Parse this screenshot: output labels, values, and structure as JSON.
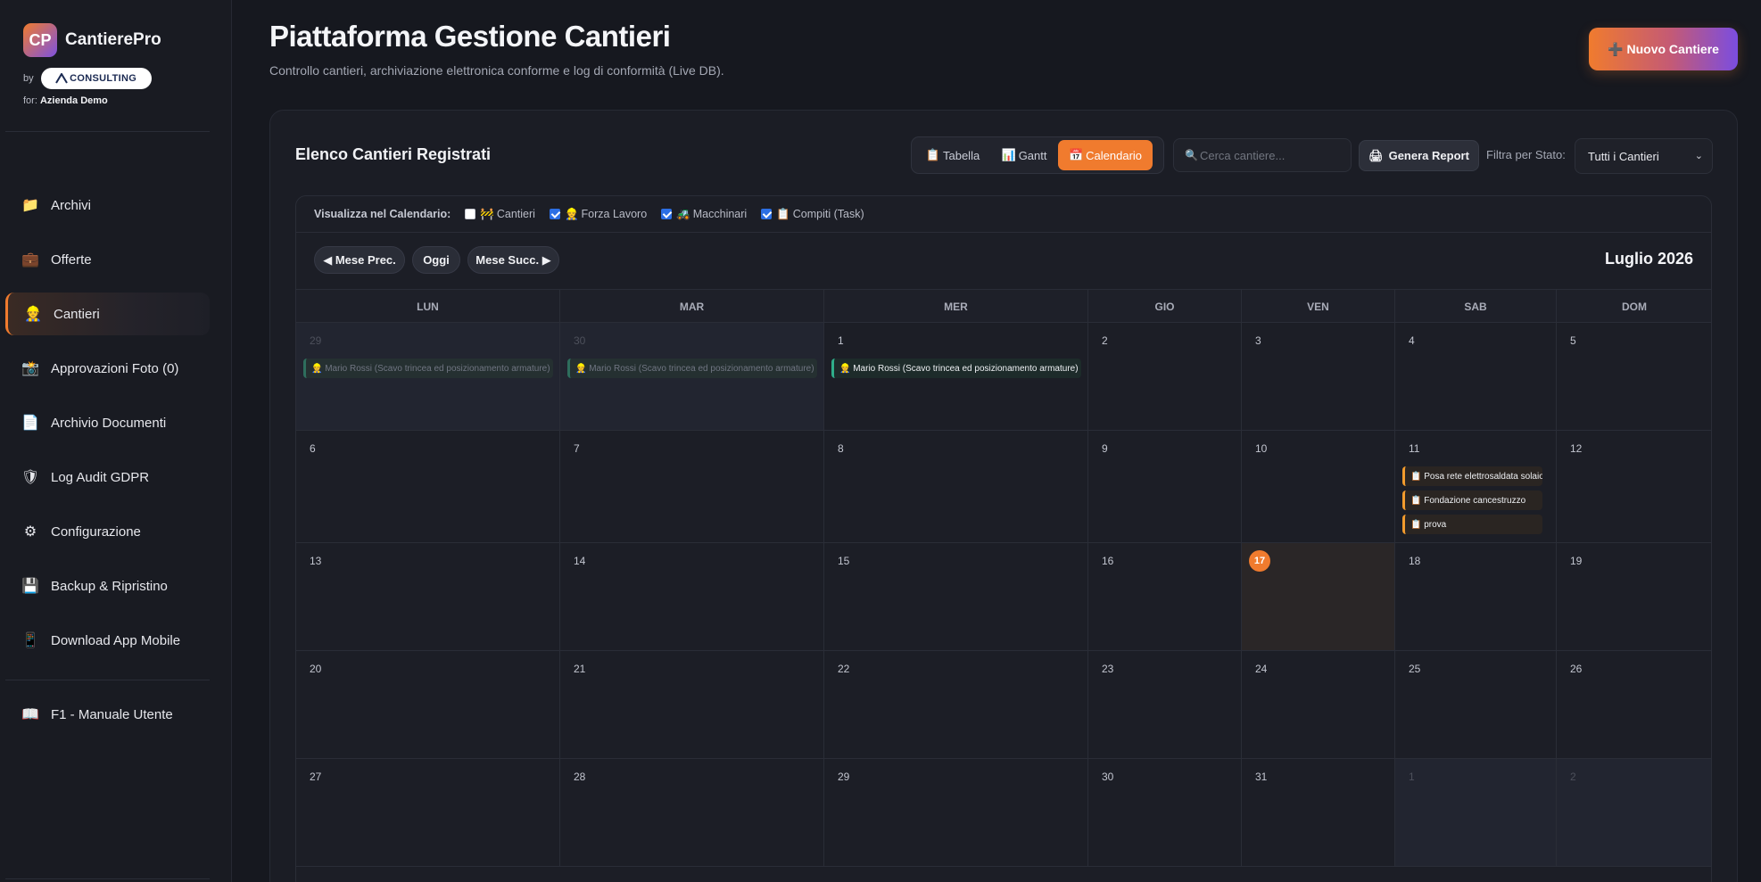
{
  "brand": {
    "logo_text": "CP",
    "name": "CantierePro",
    "by": "by",
    "partner_logo": "CONSULTING",
    "for_label": "for:",
    "company": "Azienda Demo"
  },
  "sidebar": {
    "items": [
      {
        "label": "Archivi",
        "icon": "folder-icon",
        "glyph": "📁"
      },
      {
        "label": "Offerte",
        "icon": "briefcase-icon",
        "glyph": "💼"
      },
      {
        "label": "Cantieri",
        "icon": "worker-icon",
        "glyph": "👷"
      },
      {
        "label": "Approvazioni Foto (0)",
        "icon": "camera-icon",
        "glyph": "📸"
      },
      {
        "label": "Archivio Documenti",
        "icon": "document-icon",
        "glyph": "📄"
      },
      {
        "label": "Log Audit GDPR",
        "icon": "shield-icon",
        "glyph": "🛡"
      },
      {
        "label": "Configurazione",
        "icon": "gear-icon",
        "glyph": "⚙"
      },
      {
        "label": "Backup & Ripristino",
        "icon": "floppy-icon",
        "glyph": "💾"
      },
      {
        "label": "Download App Mobile",
        "icon": "phone-icon",
        "glyph": "📱"
      }
    ],
    "manual": {
      "label": "F1 - Manuale Utente",
      "icon": "book-icon",
      "glyph": "📖"
    }
  },
  "header": {
    "title": "Piattaforma Gestione Cantieri",
    "subtitle": "Controllo cantieri, archiviazione elettronica conforme e log di conformità (Live DB).",
    "new_button": "Nuovo Cantiere",
    "new_button_icon": "➕"
  },
  "panel": {
    "title": "Elenco Cantieri Registrati",
    "views": [
      {
        "label": "Tabella",
        "glyph": "📋",
        "active": false
      },
      {
        "label": "Gantt",
        "glyph": "📊",
        "active": false
      },
      {
        "label": "Calendario",
        "glyph": "📅",
        "active": true
      }
    ],
    "search_placeholder": "Cerca cantiere...",
    "search_icon": "🔍",
    "report_button": "Genera Report",
    "report_icon": "🖨",
    "filter_label": "Filtra per Stato:",
    "filter_value": "Tutti i Cantieri"
  },
  "calendar": {
    "filters_label": "Visualizza nel Calendario:",
    "filters": [
      {
        "label": "Cantieri",
        "glyph": "🚧",
        "checked": false
      },
      {
        "label": "Forza Lavoro",
        "glyph": "👷",
        "checked": true
      },
      {
        "label": "Macchinari",
        "glyph": "🚜",
        "checked": true
      },
      {
        "label": "Compiti (Task)",
        "glyph": "📋",
        "checked": true
      }
    ],
    "nav": {
      "prev": "◀ Mese Prec.",
      "today": "Oggi",
      "next": "Mese Succ. ▶"
    },
    "month_title": "Luglio 2026",
    "weekdays": [
      "LUN",
      "MAR",
      "MER",
      "GIO",
      "VEN",
      "SAB",
      "DOM"
    ],
    "weeks": [
      [
        {
          "d": "29",
          "m": true
        },
        {
          "d": "30",
          "m": true
        },
        {
          "d": "1"
        },
        {
          "d": "2"
        },
        {
          "d": "3"
        },
        {
          "d": "4"
        },
        {
          "d": "5"
        }
      ],
      [
        {
          "d": "6"
        },
        {
          "d": "7"
        },
        {
          "d": "8"
        },
        {
          "d": "9"
        },
        {
          "d": "10"
        },
        {
          "d": "11"
        },
        {
          "d": "12"
        }
      ],
      [
        {
          "d": "13"
        },
        {
          "d": "14"
        },
        {
          "d": "15"
        },
        {
          "d": "16"
        },
        {
          "d": "17",
          "today": true
        },
        {
          "d": "18"
        },
        {
          "d": "19"
        }
      ],
      [
        {
          "d": "20"
        },
        {
          "d": "21"
        },
        {
          "d": "22"
        },
        {
          "d": "23"
        },
        {
          "d": "24"
        },
        {
          "d": "25"
        },
        {
          "d": "26"
        }
      ],
      [
        {
          "d": "27"
        },
        {
          "d": "28"
        },
        {
          "d": "29"
        },
        {
          "d": "30"
        },
        {
          "d": "31"
        },
        {
          "d": "1",
          "m": true
        },
        {
          "d": "2",
          "m": true
        }
      ]
    ],
    "events": [
      {
        "week": 0,
        "day": 0,
        "type": "worker",
        "text": "👷 Mario Rossi (Scavo trincea ed posizionamento armature)"
      },
      {
        "week": 0,
        "day": 1,
        "type": "worker",
        "text": "👷 Mario Rossi (Scavo trincea ed posizionamento armature)"
      },
      {
        "week": 0,
        "day": 2,
        "type": "worker",
        "text": "👷 Mario Rossi (Scavo trincea ed posizionamento armature)"
      },
      {
        "week": 1,
        "day": 5,
        "type": "task",
        "text": "📋 Posa rete elettrosaldata solaio"
      },
      {
        "week": 1,
        "day": 5,
        "type": "task",
        "text": "📋 Fondazione cancestruzzo"
      },
      {
        "week": 1,
        "day": 5,
        "type": "task",
        "text": "📋 prova"
      }
    ]
  }
}
